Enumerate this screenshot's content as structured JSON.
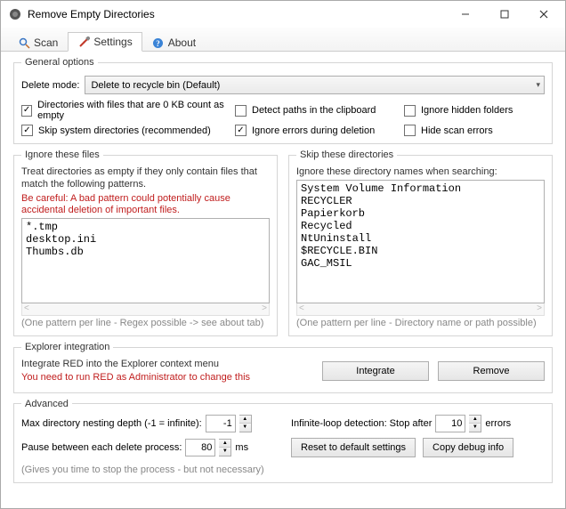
{
  "window": {
    "title": "Remove Empty Directories"
  },
  "tabs": {
    "scan": "Scan",
    "settings": "Settings",
    "about": "About"
  },
  "general": {
    "legend": "General options",
    "delete_mode_label": "Delete mode:",
    "delete_mode_value": "Delete to recycle bin (Default)",
    "chk_zero_kb": "Directories with files that are 0 KB count as empty",
    "chk_clipboard": "Detect paths in the clipboard",
    "chk_hidden": "Ignore hidden folders",
    "chk_skip_system": "Skip system directories (recommended)",
    "chk_ignore_errors": "Ignore errors during deletion",
    "chk_hide_errors": "Hide scan errors",
    "checked_zero_kb": true,
    "checked_clipboard": false,
    "checked_hidden": false,
    "checked_skip_system": true,
    "checked_ignore_errors": true,
    "checked_hide_errors": false
  },
  "ignore_files": {
    "legend": "Ignore these files",
    "hint1": "Treat directories as empty if they only contain files that match the following patterns.",
    "hint2": "Be careful: A bad pattern could potentially cause accidental deletion of important files.",
    "content": "*.tmp\ndesktop.ini\nThumbs.db",
    "note": "(One pattern per line - Regex possible -> see about tab)"
  },
  "skip_dirs": {
    "legend": "Skip these directories",
    "hint1": "Ignore these directory names when searching:",
    "content": "System Volume Information\nRECYCLER\nPapierkorb\nRecycled\nNtUninstall\n$RECYCLE.BIN\nGAC_MSIL",
    "note": "(One pattern per line - Directory name or path possible)"
  },
  "explorer": {
    "legend": "Explorer integration",
    "line1": "Integrate RED into the Explorer context menu",
    "line2": "You need to run RED as Administrator to change this",
    "btn_integrate": "Integrate",
    "btn_remove": "Remove"
  },
  "advanced": {
    "legend": "Advanced",
    "nesting_label": "Max directory nesting depth (-1 = infinite):",
    "nesting_value": "-1",
    "loop_label": "Infinite-loop detection: Stop after",
    "loop_value": "10",
    "loop_suffix": "errors",
    "pause_label": "Pause between each delete process:",
    "pause_value": "80",
    "pause_suffix": "ms",
    "pause_note": "(Gives you time to stop the process - but not necessary)",
    "btn_reset": "Reset to default settings",
    "btn_debug": "Copy debug info"
  }
}
